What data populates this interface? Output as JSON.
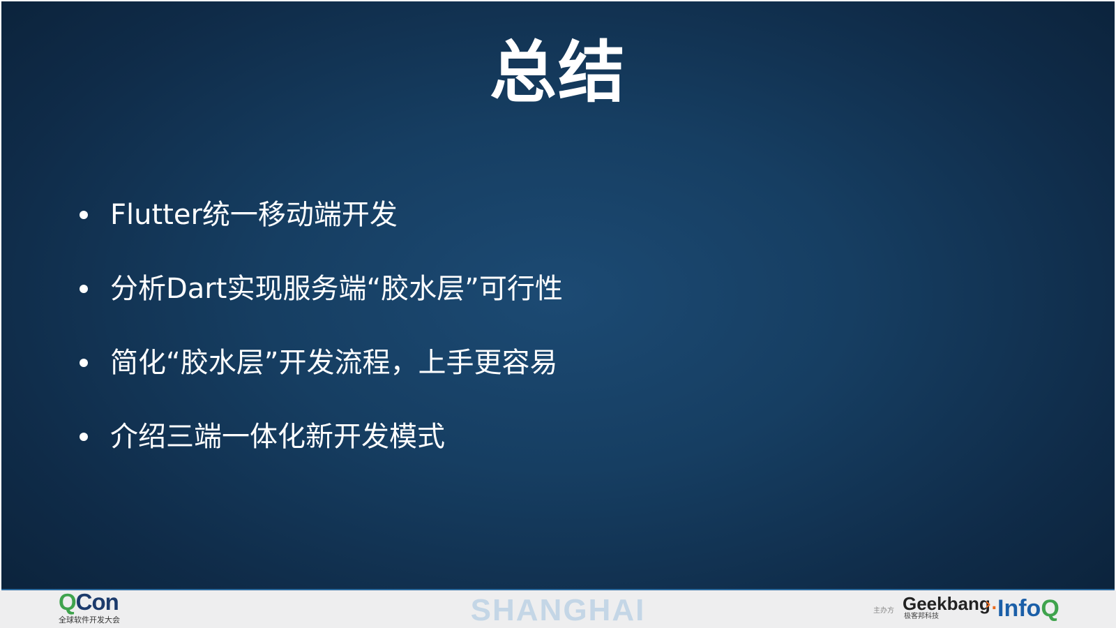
{
  "slide": {
    "title": "总结",
    "bullets": [
      "Flutter统一移动端开发",
      "分析Dart实现服务端“胶水层”可行性",
      "简化“胶水层”开发流程，上手更容易",
      "介绍三端一体化新开发模式"
    ]
  },
  "footer": {
    "qcon_logo_q": "Q",
    "qcon_logo_rest": "Con",
    "qcon_subtitle": "全球软件开发大会",
    "city": "SHANGHAI",
    "sponsor_label": "主办方",
    "geekbang_logo": "Geekbang",
    "geekbang_mark": "›.",
    "geekbang_subtitle": "极客邦科技",
    "infoq_logo_info": "Info",
    "infoq_logo_q": "Q"
  },
  "colors": {
    "background_center": "#1c4a73",
    "background_edge": "#0a1f35",
    "text": "#ffffff",
    "footer_background": "#eeeeef",
    "city_text": "#c4d6e6",
    "qcon_green": "#3fa34d",
    "qcon_navy": "#1b3a6b",
    "geekbang_orange": "#e86a1e",
    "infoq_blue": "#1b5fa8"
  }
}
